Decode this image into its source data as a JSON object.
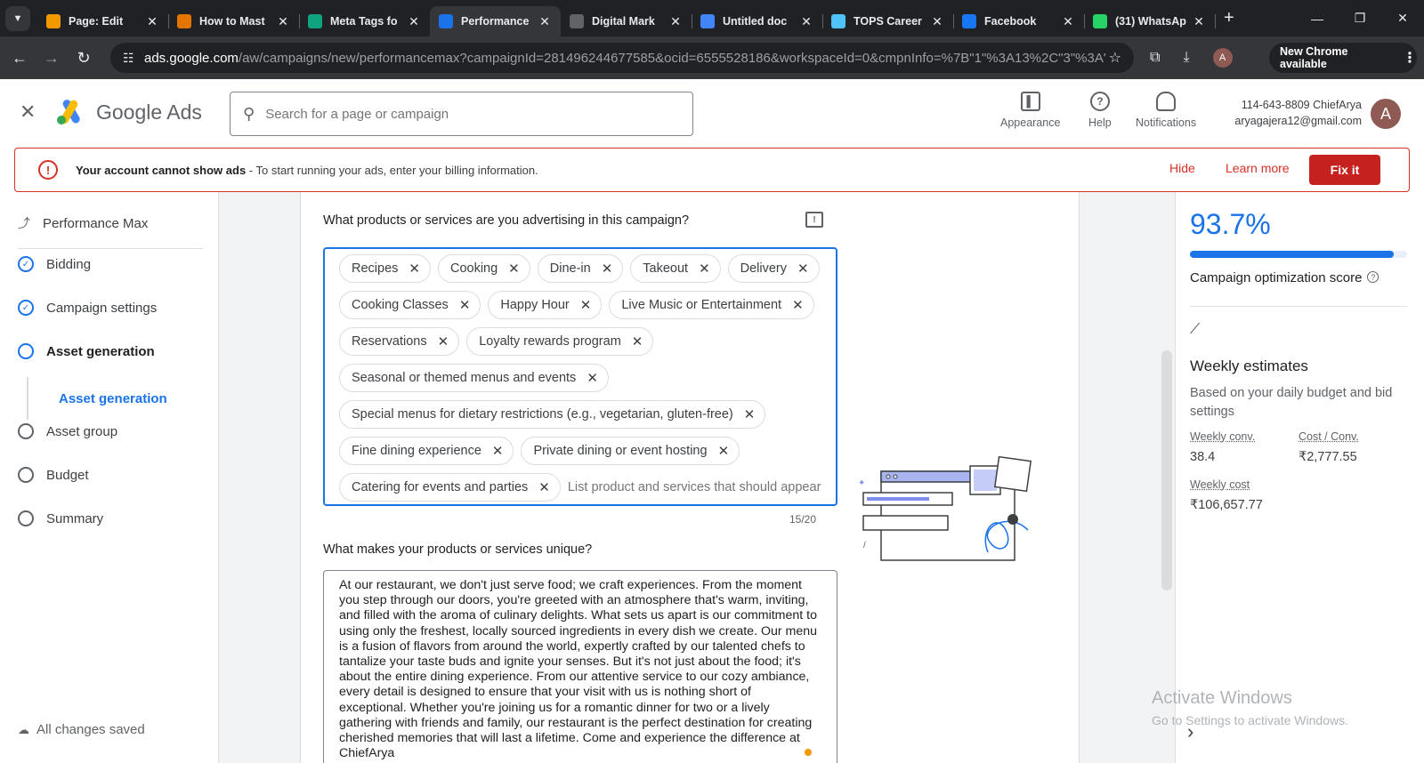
{
  "browser": {
    "tabs": [
      {
        "title": "Page: Edit",
        "icon": "blogger-icon",
        "color": "#f29900"
      },
      {
        "title": "How to Mast",
        "icon": "bookmark-icon",
        "color": "#e37400"
      },
      {
        "title": "Meta Tags fo",
        "icon": "chatgpt-icon",
        "color": "#10a37f"
      },
      {
        "title": "Performance",
        "icon": "google-ads-icon",
        "color": "#1a73e8"
      },
      {
        "title": "Digital Mark",
        "icon": "globe-icon",
        "color": "#5f6368"
      },
      {
        "title": "Untitled doc",
        "icon": "docs-icon",
        "color": "#4285f4"
      },
      {
        "title": "TOPS Career",
        "icon": "tops-icon",
        "color": "#4fc3f7"
      },
      {
        "title": "Facebook",
        "icon": "facebook-icon",
        "color": "#1877f2"
      },
      {
        "title": "(31) WhatsAp",
        "icon": "whatsapp-icon",
        "color": "#25d366"
      }
    ],
    "url_domain": "ads.google.com",
    "url_path": "/aw/campaigns/new/performancemax?campaignId=281496244677585&ocid=6555528186&workspaceId=0&cmpnInfo=%7B\"1\"%3A13%2C\"3\"%3A\"ht...",
    "update_label": "New Chrome available",
    "profile_initial": "A"
  },
  "header": {
    "product_name": "Google Ads",
    "search_placeholder": "Search for a page or campaign",
    "actions": {
      "appearance": "Appearance",
      "help": "Help",
      "notifications": "Notifications"
    },
    "account_line1": "114-643-8809 ChiefArya",
    "account_line2": "aryagajera12@gmail.com",
    "avatar_initial": "A"
  },
  "banner": {
    "bold": "Your account cannot show ads",
    "text": " - To start running your ads, enter your billing information.",
    "hide": "Hide",
    "learn_more": "Learn more",
    "fix": "Fix it"
  },
  "nav": {
    "campaign_type": "Performance Max",
    "steps": [
      {
        "label": "Bidding",
        "state": "done"
      },
      {
        "label": "Campaign settings",
        "state": "done"
      },
      {
        "label": "Asset generation",
        "state": "current"
      },
      {
        "label": "Asset group",
        "state": "todo"
      },
      {
        "label": "Budget",
        "state": "todo"
      },
      {
        "label": "Summary",
        "state": "todo"
      }
    ],
    "sub_step": "Asset generation",
    "saved": "All changes saved"
  },
  "form": {
    "question1": "What products or services are you advertising in this campaign?",
    "chip_rows": [
      [
        "Recipes",
        "Cooking",
        "Dine-in",
        "Takeout",
        "Delivery"
      ],
      [
        "Cooking Classes",
        "Happy Hour",
        "Live Music or Entertainment"
      ],
      [
        "Reservations",
        "Loyalty rewards program"
      ],
      [
        "Seasonal or themed menus and events"
      ],
      [
        "Special menus for dietary restrictions (e.g., vegetarian, gluten-free)"
      ],
      [
        "Fine dining experience",
        "Private dining or event hosting"
      ],
      [
        "Catering for events and parties"
      ]
    ],
    "chip_input_placeholder": "List product and services that should appear",
    "counter": "15/20",
    "question2": "What makes your products or services unique?",
    "description": "At our restaurant, we don't just serve food; we craft experiences. From the moment you step through our doors, you're greeted with an atmosphere that's warm, inviting, and filled with the aroma of culinary delights. What sets us apart is our commitment to using only the freshest, locally sourced ingredients in every dish we create. Our menu is a fusion of flavors from around the world, expertly crafted by our talented chefs to tantalize your taste buds and ignite your senses. But it's not just about the food; it's about the entire dining experience. From our attentive service to our cozy ambiance, every detail is designed to ensure that your visit with us is nothing short of exceptional. Whether you're joining us for a romantic dinner for two or a lively gathering with friends and family, our restaurant is the perfect destination for creating cherished memories that will last a lifetime. Come and experience the difference at ChiefArya"
  },
  "optimization": {
    "score": "93.7%",
    "score_fraction": 0.937,
    "label": "Campaign optimization score",
    "weekly_title": "Weekly estimates",
    "weekly_sub": "Based on your daily budget and bid settings",
    "weekly_conv_label": "Weekly conv.",
    "weekly_conv": "38.4",
    "cost_conv_label": "Cost / Conv.",
    "cost_conv": "₹2,777.55",
    "weekly_cost_label": "Weekly cost",
    "weekly_cost": "₹106,657.77"
  },
  "os": {
    "watermark_title": "Activate Windows",
    "watermark_sub": "Go to Settings to activate Windows."
  }
}
